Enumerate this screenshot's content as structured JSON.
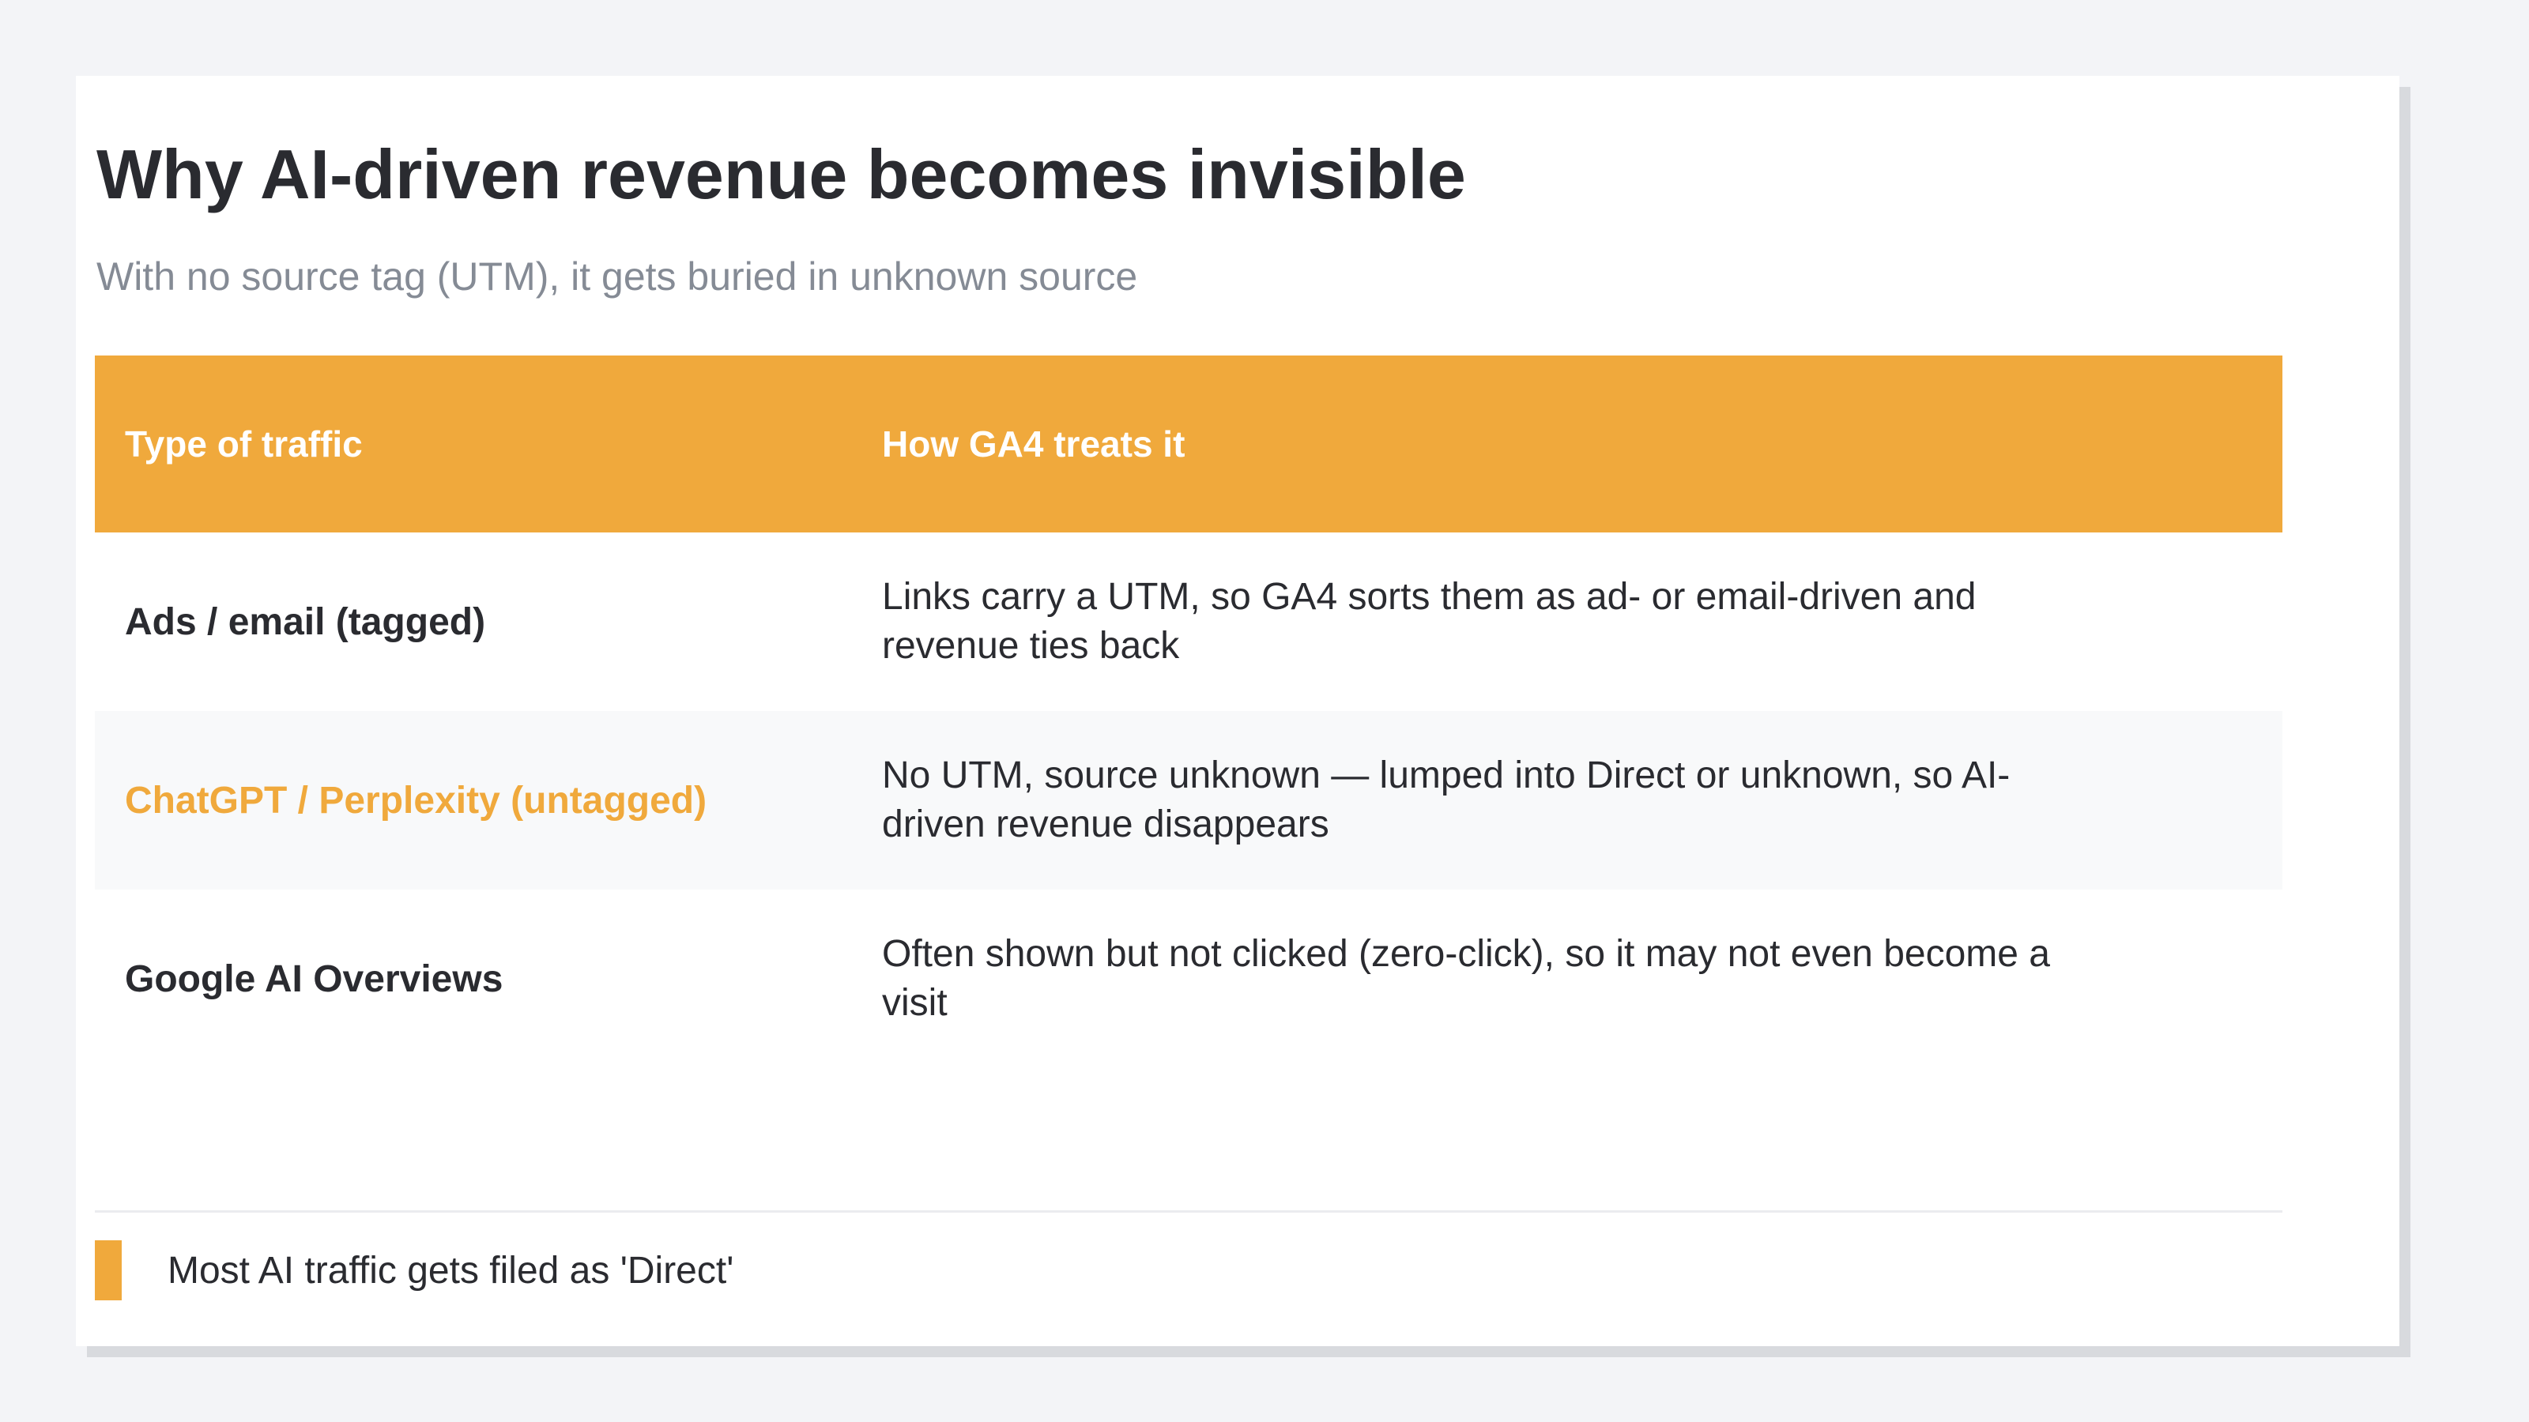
{
  "title": "Why AI-driven revenue becomes invisible",
  "subtitle": "With no source tag (UTM), it gets buried in unknown source",
  "table": {
    "headers": [
      "Type of traffic",
      "How GA4 treats it"
    ],
    "rows": [
      {
        "type": "Ads / email (tagged)",
        "treatment": "Links carry a UTM, so GA4 sorts them as ad- or email-driven and revenue ties back"
      },
      {
        "type": "ChatGPT / Perplexity (untagged)",
        "treatment": "No UTM, source unknown — lumped into Direct or unknown, so AI-driven revenue disappears"
      },
      {
        "type": "Google AI Overviews",
        "treatment": "Often shown but not clicked (zero-click), so it may not even become a visit"
      }
    ]
  },
  "callout": "Most AI traffic gets filed as 'Direct'",
  "colors": {
    "accent": "#f0a93c",
    "text": "#2a2b30",
    "muted": "#858b95",
    "background": "#f3f4f7"
  }
}
